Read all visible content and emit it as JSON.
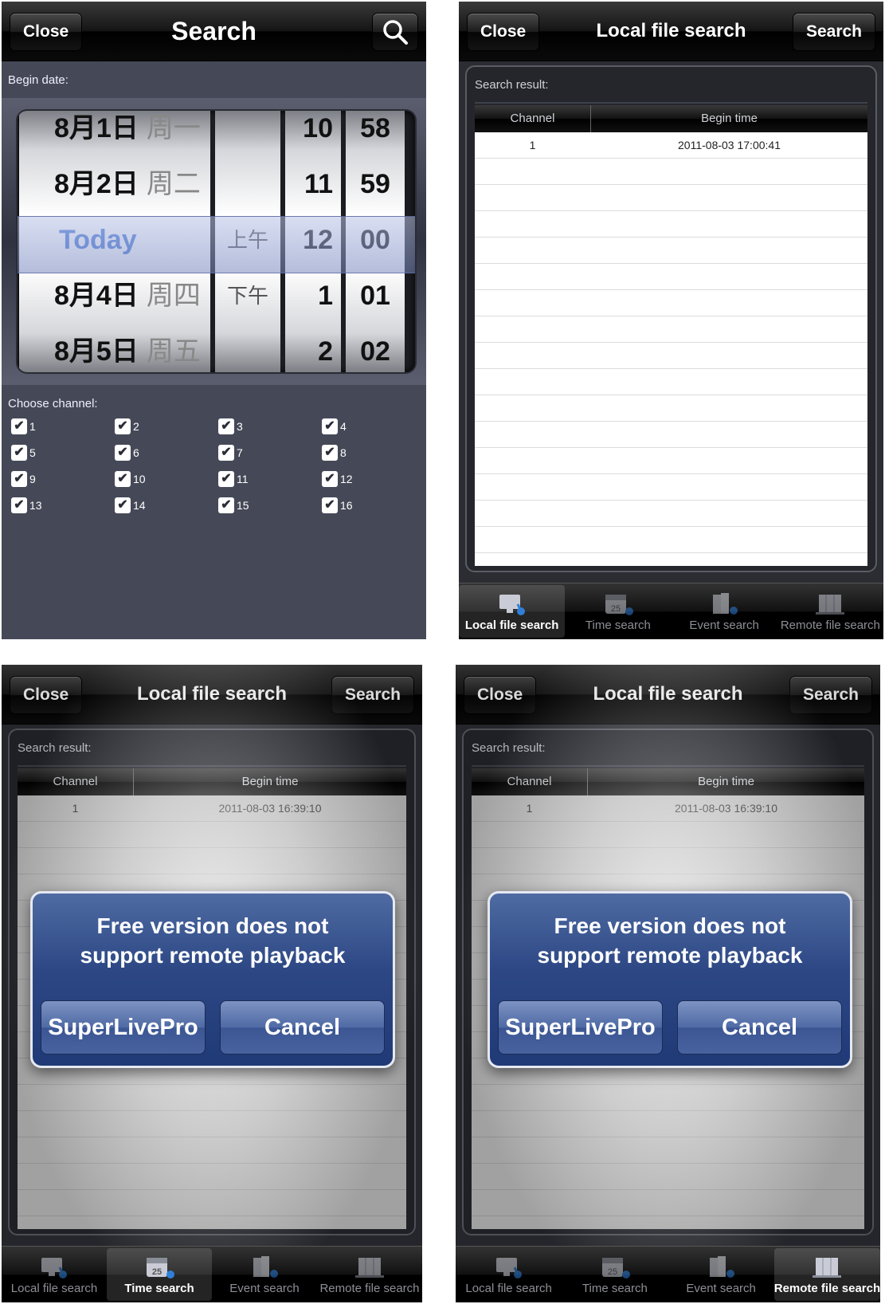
{
  "screen1": {
    "close": "Close",
    "title": "Search",
    "begin_date_label": "Begin date:",
    "picker": {
      "dates": [
        {
          "day": "8月1日",
          "weekday": "周一"
        },
        {
          "day": "8月2日",
          "weekday": "周二"
        },
        {
          "day": "Today",
          "weekday": ""
        },
        {
          "day": "8月4日",
          "weekday": "周四"
        },
        {
          "day": "8月5日",
          "weekday": "周五"
        }
      ],
      "ampm": [
        "",
        "",
        "上午",
        "下午",
        ""
      ],
      "hours": [
        "10",
        "11",
        "12",
        "1",
        "2"
      ],
      "minutes": [
        "58",
        "59",
        "00",
        "01",
        "02"
      ]
    },
    "choose_channel_label": "Choose channel:",
    "channels": [
      "1",
      "2",
      "3",
      "4",
      "5",
      "6",
      "7",
      "8",
      "9",
      "10",
      "11",
      "12",
      "13",
      "14",
      "15",
      "16"
    ],
    "check": "✔"
  },
  "screen2": {
    "close": "Close",
    "title": "Local file search",
    "search": "Search",
    "result_label": "Search result:",
    "col_channel": "Channel",
    "col_begin": "Begin time",
    "rows": [
      {
        "channel": "1",
        "begin": "2011-08-03 17:00:41"
      }
    ]
  },
  "screen3": {
    "close": "Close",
    "title": "Local file search",
    "search": "Search",
    "result_label": "Search result:",
    "col_channel": "Channel",
    "col_begin": "Begin time",
    "rows": [
      {
        "channel": "1",
        "begin": "2011-08-03 16:39:10"
      }
    ],
    "alert": {
      "line1": "Free version does not",
      "line2": "support remote playback",
      "btn_a": "SuperLivePro",
      "btn_b": "Cancel"
    }
  },
  "screen4": {
    "close": "Close",
    "title": "Local file search",
    "search": "Search",
    "result_label": "Search result:",
    "col_channel": "Channel",
    "col_begin": "Begin time",
    "rows": [
      {
        "channel": "1",
        "begin": "2011-08-03 16:39:10"
      }
    ],
    "alert": {
      "line1": "Free version does not",
      "line2": "support remote playback",
      "btn_a": "SuperLivePro",
      "btn_b": "Cancel"
    }
  },
  "tabs": [
    "Local file search",
    "Time search",
    "Event search",
    "Remote file search"
  ],
  "tab_icons": [
    "monitor-icon",
    "calendar-icon",
    "event-icon",
    "remote-file-icon"
  ],
  "active_tabs": {
    "screen2": 0,
    "screen3": 1,
    "screen4": 3
  },
  "colors": {
    "alert_blue": "#2c4784",
    "picker_today": "#4a7bd8",
    "screen_bg": "#454957"
  }
}
